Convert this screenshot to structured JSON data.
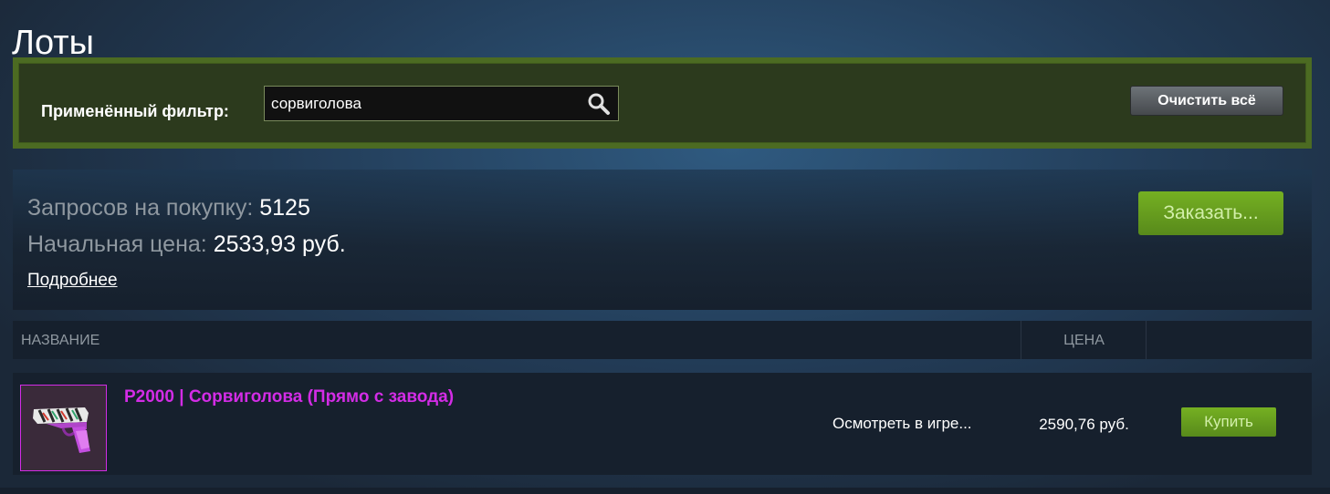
{
  "page": {
    "title": "Лоты"
  },
  "filter": {
    "label": "Применённый фильтр:",
    "value": "сорвиголова",
    "clear_label": "Очистить всё"
  },
  "summary": {
    "requests_label": "Запросов на покупку:",
    "requests_value": "5125",
    "start_price_label": "Начальная цена:",
    "start_price_value": "2533,93 руб.",
    "details_link": "Подробнее",
    "order_button": "Заказать..."
  },
  "table": {
    "columns": {
      "name": "НАЗВАНИЕ",
      "price": "ЦЕНА"
    },
    "rows": [
      {
        "name": "P2000 | Сорвиголова (Прямо с завода)",
        "inspect": "Осмотреть в игре...",
        "price": "2590,76 руб.",
        "buy_label": "Купить",
        "name_color": "#d32ce6"
      }
    ]
  },
  "colors": {
    "accent_green": "#75b022",
    "filter_border": "#4c6b22",
    "item_rarity": "#d32ce6"
  },
  "icons": {
    "search": "search-icon",
    "item": "pistol-icon"
  }
}
